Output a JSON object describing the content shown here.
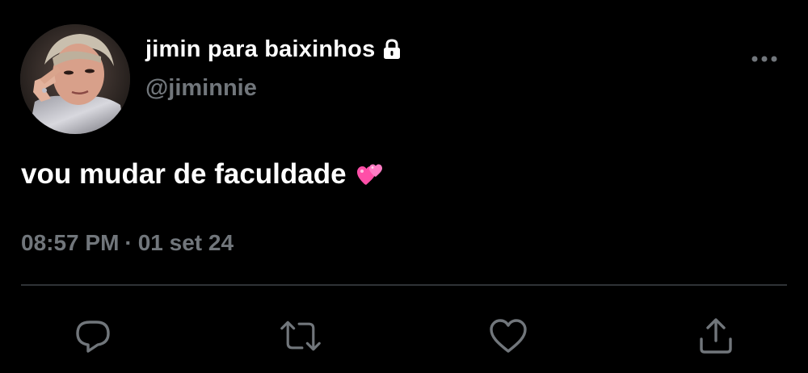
{
  "tweet": {
    "display_name": "jimin para baixinhos",
    "handle": "@jiminnie",
    "text": "vou mudar de faculdade",
    "emoji": "two-hearts",
    "time": "08:57 PM",
    "separator": "·",
    "date": "01 set 24"
  },
  "icons": {
    "lock": "lock-icon",
    "more": "more-icon",
    "reply": "reply-icon",
    "retweet": "retweet-icon",
    "like": "heart-icon",
    "share": "share-icon"
  },
  "colors": {
    "background": "#000000",
    "text": "#ffffff",
    "secondary": "#71767b",
    "divider": "#2f3336",
    "heart_emoji": "#ff5fb8"
  }
}
